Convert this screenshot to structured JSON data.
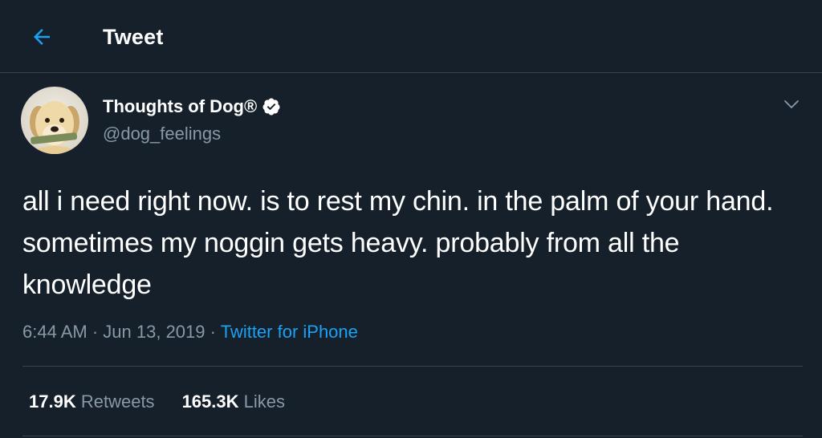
{
  "header": {
    "title": "Tweet",
    "back_icon": "arrow-left-icon",
    "accent_color": "#1da1f2"
  },
  "author": {
    "display_name": "Thoughts of Dog®",
    "handle": "@dog_feelings",
    "verified_icon": "verified-badge-icon",
    "avatar_icon": "dog-avatar",
    "menu_icon": "chevron-down-icon"
  },
  "tweet": {
    "text": "all i need right now. is to rest my chin. in the palm of your hand. sometimes my noggin gets heavy. probably from all the knowledge",
    "time": "6:44 AM",
    "date": "Jun 13, 2019",
    "separator": "·",
    "source": "Twitter for iPhone"
  },
  "stats": {
    "retweets_count": "17.9K",
    "retweets_label": "Retweets",
    "likes_count": "165.3K",
    "likes_label": "Likes"
  },
  "colors": {
    "background": "#15202b",
    "secondary_text": "#8899a6",
    "divider": "#38444d",
    "link": "#1da1f2"
  }
}
